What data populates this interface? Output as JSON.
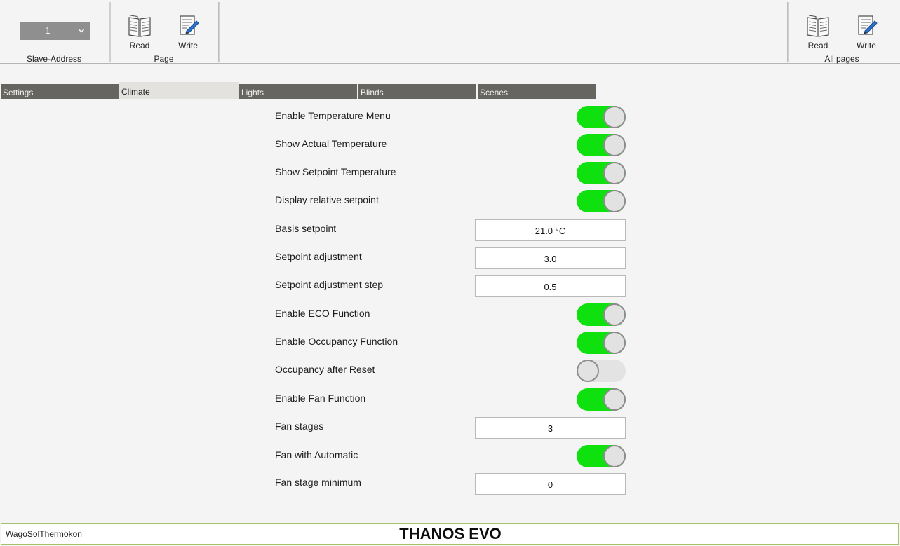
{
  "toolbar": {
    "slave": {
      "value": "1",
      "group_label": "Slave-Address"
    },
    "page": {
      "read_label": "Read",
      "write_label": "Write",
      "group_label": "Page"
    },
    "all_pages": {
      "read_label": "Read",
      "write_label": "Write",
      "group_label": "All pages"
    }
  },
  "tabs": [
    {
      "label": "Settings",
      "active": false
    },
    {
      "label": "Climate",
      "active": true
    },
    {
      "label": "Lights",
      "active": false
    },
    {
      "label": "Blinds",
      "active": false
    },
    {
      "label": "Scenes",
      "active": false
    }
  ],
  "rows": [
    {
      "label": "Enable Temperature Menu",
      "kind": "toggle",
      "on": true
    },
    {
      "label": "Show Actual Temperature",
      "kind": "toggle",
      "on": true
    },
    {
      "label": "Show Setpoint Temperature",
      "kind": "toggle",
      "on": true
    },
    {
      "label": "Display relative setpoint",
      "kind": "toggle",
      "on": true
    },
    {
      "label": "Basis setpoint",
      "kind": "field",
      "value": "21.0 °C"
    },
    {
      "label": "Setpoint adjustment",
      "kind": "field",
      "value": "3.0"
    },
    {
      "label": "Setpoint adjustment step",
      "kind": "field",
      "value": "0.5"
    },
    {
      "label": "Enable ECO Function",
      "kind": "toggle",
      "on": true
    },
    {
      "label": "Enable Occupancy Function",
      "kind": "toggle",
      "on": true
    },
    {
      "label": "Occupancy after Reset",
      "kind": "toggle",
      "on": false
    },
    {
      "label": "Enable Fan Function",
      "kind": "toggle",
      "on": true
    },
    {
      "label": "Fan stages",
      "kind": "field",
      "value": "3"
    },
    {
      "label": "Fan with Automatic",
      "kind": "toggle",
      "on": true
    },
    {
      "label": "Fan stage minimum",
      "kind": "field",
      "value": "0"
    }
  ],
  "statusbar": {
    "vendor": "WagoSolThermokon",
    "product": "THANOS EVO"
  },
  "colors": {
    "toggle_on": "#0ee10e",
    "toggle_off": "#e3e3e3",
    "tab_inactive": "#666560",
    "tab_active": "#e3e2df",
    "statusbar_border": "#a9c06a"
  },
  "icons": {
    "read": "book-read-icon",
    "write": "pencil-write-icon",
    "dropdown": "chevron-down-icon"
  }
}
